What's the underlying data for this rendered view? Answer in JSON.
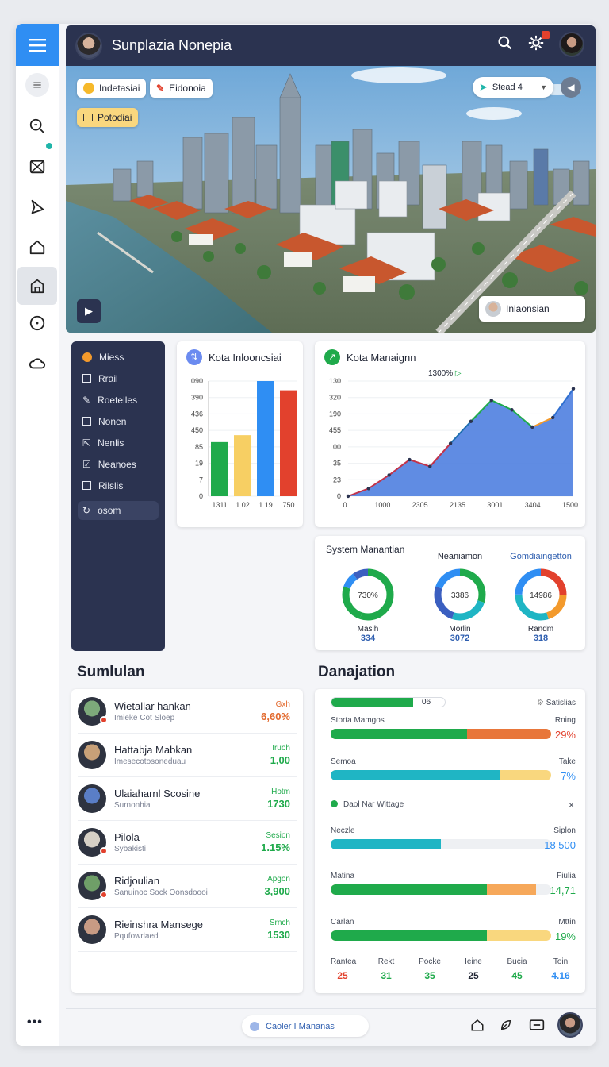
{
  "header": {
    "title": "Sunplazia Nonepia"
  },
  "hero": {
    "chips": [
      "Indetasiai",
      "Eidonoia",
      "Potodiai"
    ],
    "dropdown_label": "Stead 4",
    "location_label": "Inlaonsian"
  },
  "sidebar_menu": {
    "items": [
      "Miess",
      "Rrail",
      "Roetelles",
      "Nonen",
      "Nenlis",
      "Neanoes",
      "Rilslis"
    ],
    "selected": "osom"
  },
  "bar_card": {
    "title": "Kota Inlooncsiai",
    "yticks": [
      "090",
      "390",
      "436",
      "450",
      "85",
      "19",
      "7",
      "0"
    ],
    "xticks": [
      "1311",
      "1 02",
      "1 19",
      "750"
    ],
    "chart_data": {
      "type": "bar",
      "categories": [
        "1311",
        "1 02",
        "1 19",
        "750"
      ],
      "values": [
        47,
        53,
        100,
        92
      ],
      "colors": [
        "#1faa4b",
        "#f7cf63",
        "#2f8ef3",
        "#e2412d"
      ],
      "ylim": [
        0,
        100
      ]
    }
  },
  "area_card": {
    "title": "Kota Manaignn",
    "annotation": "1300%",
    "yticks": [
      "130",
      "320",
      "190",
      "455",
      "00",
      "35",
      "23",
      "0"
    ],
    "xticks": [
      "0",
      "1000",
      "2305",
      "2135",
      "3001",
      "3404",
      "1500"
    ],
    "chart_data": {
      "type": "area",
      "x": [
        0,
        1,
        2,
        3,
        4,
        5,
        6,
        7,
        8,
        9,
        10,
        11
      ],
      "y": [
        0,
        8,
        22,
        38,
        31,
        55,
        78,
        100,
        90,
        72,
        82,
        112
      ],
      "ylim": [
        0,
        120
      ]
    }
  },
  "system_card": {
    "title": "System Manantian",
    "gauges": [
      {
        "heading": "",
        "value": "730%",
        "label": "Masih",
        "number": "334",
        "colors": [
          "#1faa4b",
          "#1faa4b",
          "#2f8ef3",
          "#3b5fc0"
        ],
        "fractions": [
          0.55,
          0.25,
          0.1,
          0.1
        ]
      },
      {
        "heading": "Neaniamon",
        "value": "3386",
        "label": "Morlin",
        "number": "3072",
        "colors": [
          "#1faa4b",
          "#1fb5c4",
          "#3b5fc0",
          "#2f8ef3"
        ],
        "fractions": [
          0.3,
          0.25,
          0.25,
          0.2
        ]
      },
      {
        "heading": "Gomdiaingetton",
        "value": "14986",
        "label": "Randm",
        "number": "318",
        "colors": [
          "#e2412d",
          "#f39a2c",
          "#1fb5c4",
          "#2f8ef3"
        ],
        "fractions": [
          0.25,
          0.2,
          0.3,
          0.25
        ]
      }
    ]
  },
  "sumulian": {
    "title": "Sumlulan",
    "rows": [
      {
        "name": "Wietallar hankan",
        "sub": "Imieke Cot Sloep",
        "label": "Gxh",
        "value": "6,60%",
        "color": "#e2692d"
      },
      {
        "name": "Hattabja Mabkan",
        "sub": "Imesecotosoneduau",
        "label": "Iruoh",
        "value": "1,00",
        "color": "#1faa4b"
      },
      {
        "name": "Ulaiaharnl Scosine",
        "sub": "Surnonhia",
        "label": "Hotm",
        "value": "1730",
        "color": "#1faa4b"
      },
      {
        "name": "Pilola",
        "sub": "Sybakisti",
        "label": "Sesion",
        "value": "1.15%",
        "color": "#1faa4b"
      },
      {
        "name": "Ridjoulian",
        "sub": "Sanuinoc Sock Oonsdoooi",
        "label": "Apgon",
        "value": "3,900",
        "color": "#1faa4b"
      },
      {
        "name": "Rieinshra Mansege",
        "sub": "Pqufowrlaed",
        "label": "Srnch",
        "value": "1530",
        "color": "#1faa4b"
      }
    ]
  },
  "danajation": {
    "title": "Danajation",
    "top_bar": {
      "pill": "06",
      "fill": 0.4,
      "right_label": "Satislias"
    },
    "bars": [
      {
        "label": "Storta Mamgos",
        "right_label": "Rning",
        "value": "29%",
        "value_color": "#e2412d",
        "fill_a": 0.62,
        "fill_b": 1.0,
        "color_a": "#1faa4b",
        "color_b": "#e8763a"
      },
      {
        "label": "Semoa",
        "right_label": "Take",
        "value": "7%",
        "value_color": "#2f8ef3",
        "fill_a": 0.77,
        "fill_b": 1.0,
        "color_a": "#1fb5c4",
        "color_b": "#f9d77e"
      }
    ],
    "legend": {
      "label": "Daol Nar Wittage",
      "close": "×"
    },
    "bars2": [
      {
        "label": "Neczle",
        "right_label": "Siplon",
        "value": "18 500",
        "value_color": "#2f8ef3",
        "fill_a": 0.5,
        "fill_b": 0.5,
        "color_a": "#1fb5c4",
        "color_b": "#1fb5c4"
      },
      {
        "label": "Matina",
        "right_label": "Fiulia",
        "value": "14,71",
        "value_color": "#1faa4b",
        "fill_a": 0.71,
        "fill_b": 0.93,
        "color_a": "#1faa4b",
        "color_b": "#f6a85a"
      },
      {
        "label": "Carlan",
        "right_label": "Mttin",
        "value": "19%",
        "value_color": "#1faa4b",
        "fill_a": 0.71,
        "fill_b": 1.0,
        "color_a": "#1faa4b",
        "color_b": "#f9d77e"
      }
    ],
    "stats": [
      {
        "label": "Rantea",
        "value": "25",
        "color": "#e2412d"
      },
      {
        "label": "Rekt",
        "value": "31",
        "color": "#1faa4b"
      },
      {
        "label": "Pocke",
        "value": "35",
        "color": "#1faa4b"
      },
      {
        "label": "Ieine",
        "value": "25",
        "color": "#1f2433"
      },
      {
        "label": "Bucia",
        "value": "45",
        "color": "#1faa4b"
      },
      {
        "label": "Toin",
        "value": "4.16",
        "color": "#2f8ef3"
      }
    ]
  },
  "footer": {
    "search_label": "Caoler I Mananas"
  },
  "colors": {
    "accent": "#2f8ef3",
    "nav": "#2b3350",
    "green": "#1faa4b",
    "red": "#e2412d"
  }
}
